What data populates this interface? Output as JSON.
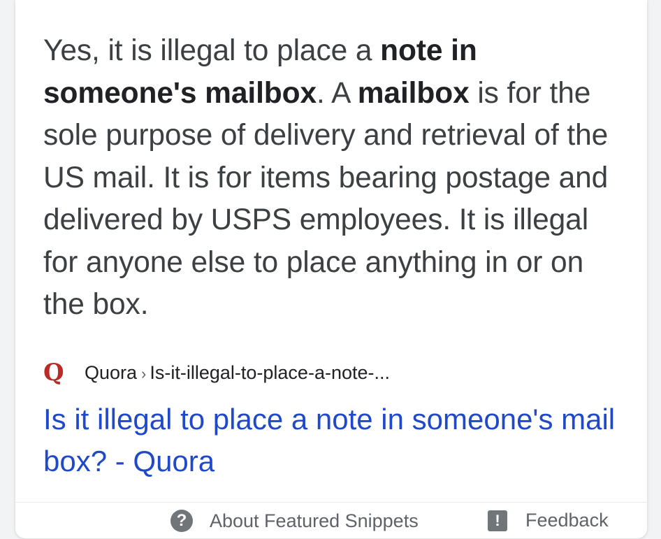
{
  "snippet": {
    "part1": "Yes, it is illegal to place a ",
    "bold1": "note in someone's mailbox",
    "part2": ". A ",
    "bold2": "mailbox",
    "part3": " is for the sole purpose of delivery and retrieval of the US mail. It is for items bearing postage and delivered by USPS employees. It is illegal for anyone else to place anything in or on the box."
  },
  "source": {
    "favicon_letter": "Q",
    "favicon_color": "#b92b27",
    "site": "Quora",
    "separator": "›",
    "path": "Is-it-illegal-to-place-a-note-..."
  },
  "result": {
    "title": "Is it illegal to place a note in someone's mail box? - Quora",
    "link_color": "#1f49c9"
  },
  "footer": {
    "help_icon_glyph": "?",
    "about_label": "About Featured Snippets",
    "feedback_icon_glyph": "!",
    "feedback_label": "Feedback"
  }
}
